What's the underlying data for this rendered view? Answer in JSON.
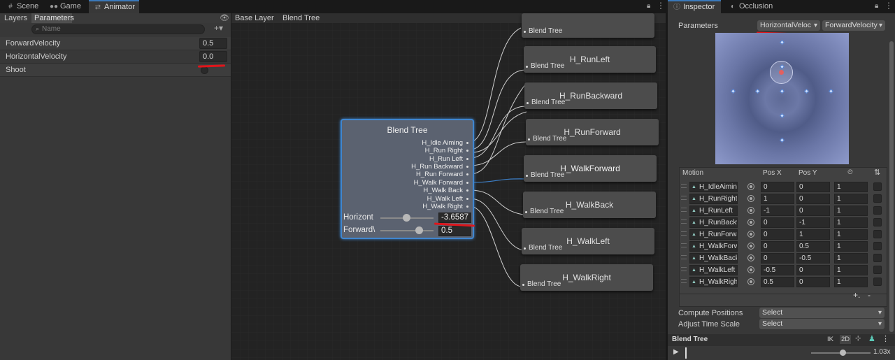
{
  "tabs": {
    "scene": "Scene",
    "game": "Game",
    "animator": "Animator",
    "inspector": "Inspector",
    "occlusion": "Occlusion"
  },
  "params_panel": {
    "tab_layers": "Layers",
    "tab_parameters": "Parameters",
    "search_placeholder": "Name",
    "add_label": "+▾",
    "params": [
      {
        "name": "ForwardVelocity",
        "value": "0.5"
      },
      {
        "name": "HorizontalVelocity",
        "value": "0.0"
      },
      {
        "name": "Shoot",
        "value": ""
      }
    ]
  },
  "breadcrumb": {
    "base_layer": "Base Layer",
    "blend_tree": "Blend Tree"
  },
  "blend_tree_node": {
    "title": "Blend Tree",
    "outputs": [
      "H_Idle Aiming",
      "H_Run Right",
      "H_Run Left",
      "H_Run Backward",
      "H_Run Forward",
      "H_Walk Forward",
      "H_Walk Back",
      "H_Walk Left",
      "H_Walk Right"
    ],
    "horizontal_label": "Horizont",
    "horizontal_value": "-3.6587",
    "forward_label": "Forward\\",
    "forward_value": "0.5"
  },
  "child_nodes": [
    {
      "title": "",
      "sub": "Blend Tree"
    },
    {
      "title": "H_RunLeft",
      "sub": "Blend Tree"
    },
    {
      "title": "H_RunBackward",
      "sub": "Blend Tree"
    },
    {
      "title": "H_RunForward",
      "sub": "Blend Tree"
    },
    {
      "title": "H_WalkForward",
      "sub": "Blend Tree"
    },
    {
      "title": "H_WalkBack",
      "sub": "Blend Tree"
    },
    {
      "title": "H_WalkLeft",
      "sub": "Blend Tree"
    },
    {
      "title": "H_WalkRight",
      "sub": "Blend Tree"
    }
  ],
  "inspector": {
    "parameters_label": "Parameters",
    "param_x": "HorizontalVeloc",
    "param_y": "ForwardVelocity",
    "col_motion": "Motion",
    "col_posx": "Pos X",
    "col_posy": "Pos Y",
    "motions": [
      {
        "name": "H_IdleAiming",
        "x": "0",
        "y": "0",
        "t": "1"
      },
      {
        "name": "H_RunRight",
        "x": "1",
        "y": "0",
        "t": "1"
      },
      {
        "name": "H_RunLeft",
        "x": "-1",
        "y": "0",
        "t": "1"
      },
      {
        "name": "H_RunBackwar",
        "x": "0",
        "y": "-1",
        "t": "1"
      },
      {
        "name": "H_RunForward",
        "x": "0",
        "y": "1",
        "t": "1"
      },
      {
        "name": "H_WalkForwar",
        "x": "0",
        "y": "0.5",
        "t": "1"
      },
      {
        "name": "H_WalkBack",
        "x": "0",
        "y": "-0.5",
        "t": "1"
      },
      {
        "name": "H_WalkLeft",
        "x": "-0.5",
        "y": "0",
        "t": "1"
      },
      {
        "name": "H_WalkRight",
        "x": "0.5",
        "y": "0",
        "t": "1"
      }
    ],
    "add_remove": "+,   -",
    "compute_positions_label": "Compute Positions",
    "compute_positions_value": "Select",
    "adjust_time_label": "Adjust Time Scale",
    "adjust_time_value": "Select"
  },
  "preview": {
    "title": "Blend Tree",
    "ik": "IK",
    "twod": "2D",
    "speed": "1.03x"
  }
}
